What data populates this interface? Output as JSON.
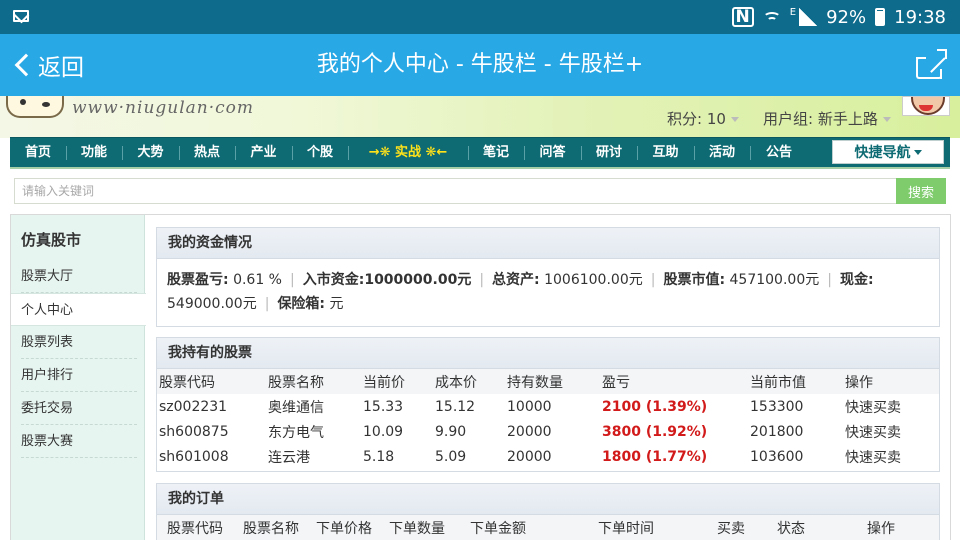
{
  "status_bar": {
    "nfc": "N",
    "network": "E",
    "battery": "92%",
    "time": "19:38"
  },
  "titlebar": {
    "back_label": "返回",
    "title": "我的个人中心 - 牛股栏 - 牛股栏+"
  },
  "header": {
    "site_url": "www·niugulan·com",
    "points_label": "积分: 10",
    "usergroup_label": "用户组: 新手上路"
  },
  "nav": {
    "items": [
      "首页",
      "功能",
      "大势",
      "热点",
      "产业",
      "个股",
      "→❋ 实战 ❋←",
      "笔记",
      "问答",
      "研讨",
      "互助",
      "活动",
      "公告"
    ],
    "quick_nav": "快捷导航"
  },
  "search": {
    "placeholder": "请输入关键词",
    "button": "搜索"
  },
  "sidebar": {
    "title": "仿真股市",
    "items": [
      "股票大厅",
      "个人中心",
      "股票列表",
      "用户排行",
      "委托交易",
      "股票大赛"
    ],
    "active_index": 1
  },
  "funds": {
    "title": "我的资金情况",
    "profit_label": "股票盈亏:",
    "profit_value": "0.61 %",
    "capital_label": "入市资金:",
    "capital_value": "1000000.00元",
    "total_label": "总资产:",
    "total_value": "1006100.00元",
    "market_label": "股票市值:",
    "market_value": "457100.00元",
    "cash_label": "现金:",
    "cash_value": "549000.00元",
    "safe_label": "保险箱:",
    "safe_value": "元"
  },
  "holdings": {
    "title": "我持有的股票",
    "columns": [
      "股票代码",
      "股票名称",
      "当前价",
      "成本价",
      "持有数量",
      "盈亏",
      "当前市值",
      "操作"
    ],
    "rows": [
      {
        "code": "sz002231",
        "name": "奥维通信",
        "price": "15.33",
        "cost": "15.12",
        "qty": "10000",
        "pnl": "2100 (1.39%)",
        "value": "153300",
        "op": "快速买卖"
      },
      {
        "code": "sh600875",
        "name": "东方电气",
        "price": "10.09",
        "cost": "9.90",
        "qty": "20000",
        "pnl": "3800 (1.92%)",
        "value": "201800",
        "op": "快速买卖"
      },
      {
        "code": "sh601008",
        "name": "连云港",
        "price": "5.18",
        "cost": "5.09",
        "qty": "20000",
        "pnl": "1800 (1.77%)",
        "value": "103600",
        "op": "快速买卖"
      }
    ]
  },
  "orders": {
    "title": "我的订单",
    "columns": [
      "股票代码",
      "股票名称",
      "下单价格",
      "下单数量",
      "下单金额",
      "下单时间",
      "买卖",
      "状态",
      "操作"
    ]
  },
  "colors": {
    "status_bar": "#0f6b8c",
    "title_bar": "#29a8e6",
    "nav_bg": "#0e6b73",
    "profit_red": "#d21a1a",
    "search_btn": "#7fcc6c"
  }
}
